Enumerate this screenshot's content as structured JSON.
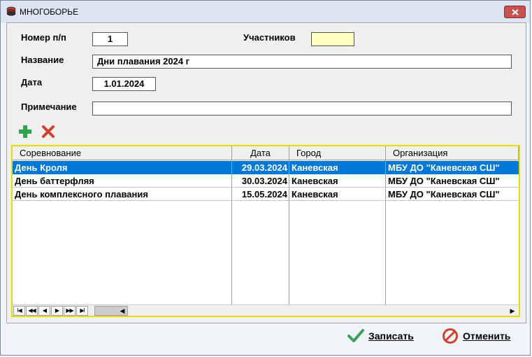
{
  "window": {
    "title": "МНОГОБОРЬЕ"
  },
  "form": {
    "number_label": "Номер п/п",
    "number_value": "1",
    "participants_label": "Участников",
    "participants_value": "",
    "name_label": "Название",
    "name_value": "Дни плавания 2024 г",
    "date_label": "Дата",
    "date_value": "1.01.2024",
    "note_label": "Примечание",
    "note_value": ""
  },
  "toolbar": {
    "add_icon": "plus-icon",
    "delete_icon": "x-icon"
  },
  "grid": {
    "columns": [
      "Соревнование",
      "Дата",
      "Город",
      "Организация"
    ],
    "rows": [
      {
        "competition": "День Кроля",
        "date": "29.03.2024",
        "city": "Каневская",
        "org": "МБУ ДО \"Каневская СШ\""
      },
      {
        "competition": "День баттерфляя",
        "date": "30.03.2024",
        "city": "Каневская",
        "org": "МБУ ДО \"Каневская СШ\""
      },
      {
        "competition": "День комплексного плавания",
        "date": "15.05.2024",
        "city": "Каневская",
        "org": "МБУ ДО \"Каневская СШ\""
      }
    ],
    "nav": [
      "I◀",
      "◀◀",
      "◀",
      "▶",
      "▶▶",
      "▶I"
    ]
  },
  "actions": {
    "save_label": "Записать",
    "cancel_label": "Отменить"
  },
  "colors": {
    "selection": "#0078d7",
    "grid_border": "#e6dc00",
    "highlight_field": "#ffffc0"
  }
}
